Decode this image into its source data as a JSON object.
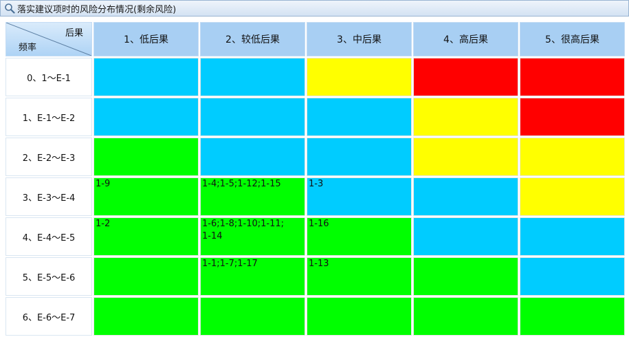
{
  "window": {
    "title": "落实建议项时的风险分布情况(剩余风险)"
  },
  "header": {
    "corner_top": "后果",
    "corner_bottom": "频率",
    "columns": [
      "1、低后果",
      "2、较低后果",
      "3、中后果",
      "4、高后果",
      "5、很高后果"
    ]
  },
  "colors": {
    "blue": "#00ccff",
    "yellow": "#ffff00",
    "red": "#ff0000",
    "green": "#00ff00"
  },
  "rows": [
    {
      "label": "0、1～E-1",
      "cells": [
        {
          "color": "blue",
          "text": ""
        },
        {
          "color": "blue",
          "text": ""
        },
        {
          "color": "yellow",
          "text": ""
        },
        {
          "color": "red",
          "text": ""
        },
        {
          "color": "red",
          "text": ""
        }
      ]
    },
    {
      "label": "1、E-1～E-2",
      "cells": [
        {
          "color": "blue",
          "text": ""
        },
        {
          "color": "blue",
          "text": ""
        },
        {
          "color": "blue",
          "text": ""
        },
        {
          "color": "yellow",
          "text": ""
        },
        {
          "color": "red",
          "text": ""
        }
      ]
    },
    {
      "label": "2、E-2～E-3",
      "cells": [
        {
          "color": "green",
          "text": ""
        },
        {
          "color": "blue",
          "text": ""
        },
        {
          "color": "blue",
          "text": ""
        },
        {
          "color": "yellow",
          "text": ""
        },
        {
          "color": "yellow",
          "text": ""
        }
      ]
    },
    {
      "label": "3、E-3～E-4",
      "cells": [
        {
          "color": "green",
          "text": "1-9"
        },
        {
          "color": "green",
          "text": "1-4;1-5;1-12;1-15"
        },
        {
          "color": "blue",
          "text": "1-3"
        },
        {
          "color": "blue",
          "text": ""
        },
        {
          "color": "yellow",
          "text": ""
        }
      ]
    },
    {
      "label": "4、E-4～E-5",
      "cells": [
        {
          "color": "green",
          "text": "1-2"
        },
        {
          "color": "green",
          "text": "1-6;1-8;1-10;1-11;\n1-14"
        },
        {
          "color": "green",
          "text": "1-16"
        },
        {
          "color": "blue",
          "text": ""
        },
        {
          "color": "blue",
          "text": ""
        }
      ]
    },
    {
      "label": "5、E-5～E-6",
      "cells": [
        {
          "color": "green",
          "text": ""
        },
        {
          "color": "green",
          "text": "1-1;1-7;1-17"
        },
        {
          "color": "green",
          "text": "1-13"
        },
        {
          "color": "green",
          "text": ""
        },
        {
          "color": "blue",
          "text": ""
        }
      ]
    },
    {
      "label": "6、E-6～E-7",
      "cells": [
        {
          "color": "green",
          "text": ""
        },
        {
          "color": "green",
          "text": ""
        },
        {
          "color": "green",
          "text": ""
        },
        {
          "color": "green",
          "text": ""
        },
        {
          "color": "green",
          "text": ""
        }
      ]
    }
  ]
}
